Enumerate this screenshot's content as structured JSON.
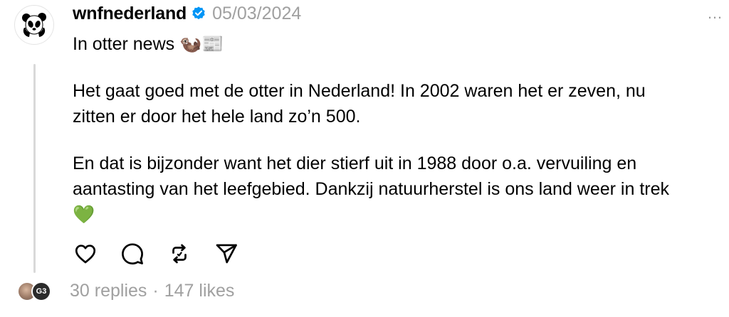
{
  "post": {
    "username": "wnfnederland",
    "date": "05/03/2024",
    "more_label": "…",
    "lines": [
      "In otter news 🦦📰",
      "Het gaat goed met de otter in Nederland! In 2002 waren het er zeven, nu",
      "zitten er door het hele land zo’n 500.",
      "En dat is bijzonder want het dier stierf uit in 1988 door o.a. vervuiling en",
      "aantasting van het leefgebied. Dankzij natuurherstel is ons land weer in trek",
      "💚"
    ]
  },
  "footer": {
    "replies": "30 replies",
    "separator": "·",
    "likes": "147 likes",
    "avatar2_initials": "G3"
  },
  "icons": {
    "like": "heart-icon",
    "reply": "comment-icon",
    "repost": "repost-icon",
    "share": "send-icon",
    "verified": "verified-badge-icon"
  },
  "colors": {
    "verified": "#0095f6",
    "muted": "#a0a0a0",
    "thread_line": "#d9d9d9"
  }
}
